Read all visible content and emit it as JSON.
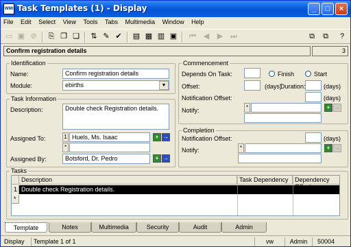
{
  "window": {
    "title": "Task Templates (1) - Display",
    "app_icon_text": "WMI"
  },
  "menu": [
    "File",
    "Edit",
    "Select",
    "View",
    "Tools",
    "Tabs",
    "Multimedia",
    "Window",
    "Help"
  ],
  "record": {
    "title": "Confirm registration details",
    "number": "3"
  },
  "identification": {
    "legend": "Identification",
    "name_label": "Name:",
    "name_value": "Confirm registration details",
    "module_label": "Module:",
    "module_value": "ebirths"
  },
  "task_information": {
    "legend": "Task Information",
    "description_label": "Description:",
    "description_value": "Double check Registration details.",
    "assigned_to_label": "Assigned To:",
    "assigned_to_row": "1",
    "assigned_to_value": "Huels, Ms. Isaac",
    "assigned_by_label": "Assigned By:",
    "assigned_by_value": "Botsford, Dr. Pedro"
  },
  "commencement": {
    "legend": "Commencement",
    "depends_label": "Depends On Task:",
    "finish_label": "Finish",
    "start_label": "Start",
    "offset_label": "Offset:",
    "days1": "(days)",
    "duration_label": "Duration:",
    "days2": "(days)",
    "notification_offset_label": "Notification Offset:",
    "days3": "(days)",
    "notify_label": "Notify:"
  },
  "completion": {
    "legend": "Completion",
    "notification_offset_label": "Notification Offset:",
    "days": "(days)",
    "notify_label": "Notify:"
  },
  "tasks": {
    "legend": "Tasks",
    "columns": [
      "Description",
      "Task Dependency",
      "Dependency Offset"
    ],
    "rows": [
      {
        "num": "1",
        "description": "Double check Registration details.",
        "dependency": "",
        "offset": ""
      }
    ]
  },
  "tabs": [
    "Template",
    "Notes",
    "Multimedia",
    "Security",
    "Audit",
    "Admin"
  ],
  "status": {
    "mode": "Display",
    "position": "Template 1 of 1",
    "code": "vw",
    "user": "Admin",
    "port": "50004"
  },
  "icons": {
    "new_row": "*"
  }
}
